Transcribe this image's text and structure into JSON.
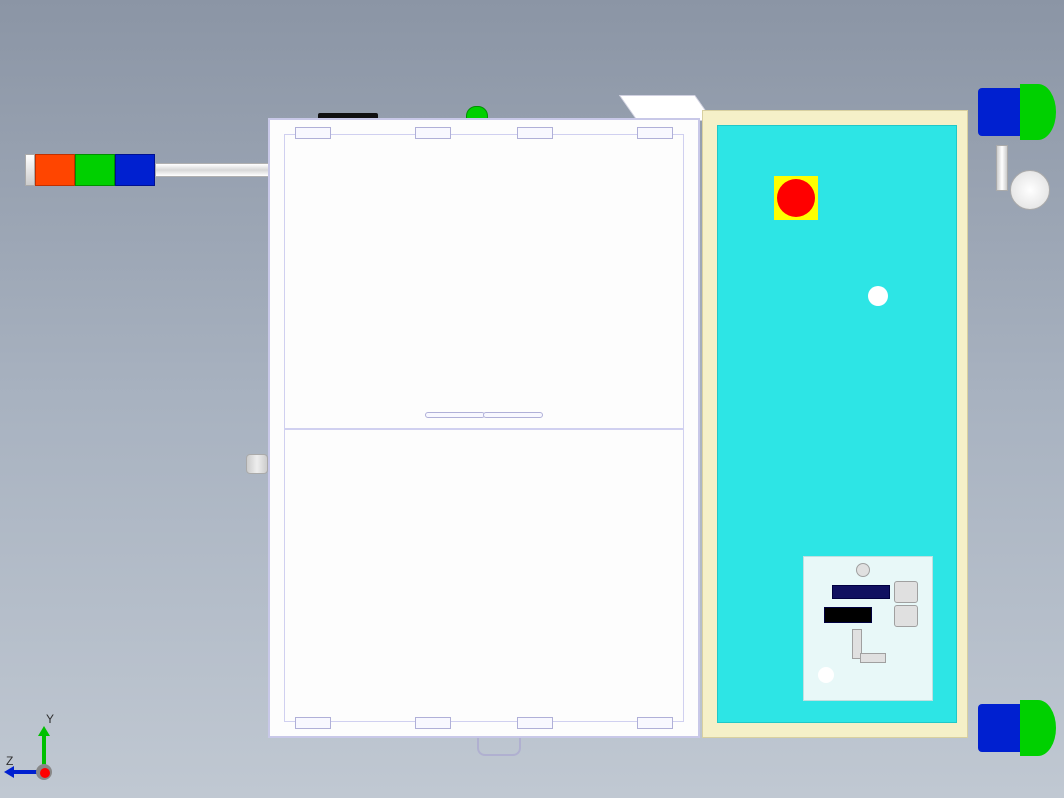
{
  "view": {
    "axes": {
      "up": "Y",
      "left": "Z",
      "out": "X"
    },
    "background_gradient": [
      "#8b95a5",
      "#c0c8d2"
    ]
  },
  "assembly": {
    "main_enclosure": {
      "type": "aluminum-extrusion-frame",
      "doors": 2,
      "hinges_per_door": 4,
      "handles": 2
    },
    "control_panel": {
      "face_color": "#2de5e5",
      "bezel_color": "#f5f0c8",
      "emergency_stop": {
        "housing_color": "#ffff00",
        "button_color": "#ff0000"
      },
      "indicator_count": 2,
      "pneumatic_frl": true
    },
    "signal_tower": {
      "segments": [
        "red",
        "green",
        "blue"
      ],
      "colors": {
        "red": "#ff4500",
        "green": "#00d000",
        "blue": "#0020d0"
      }
    },
    "motors": {
      "count": 2,
      "body_color": "#0020d0",
      "cap_color": "#00d000"
    }
  },
  "triad": {
    "y_label": "Y",
    "z_label": "Z",
    "x_color": "#ff0000",
    "y_color": "#00c000",
    "z_color": "#0020d0"
  }
}
